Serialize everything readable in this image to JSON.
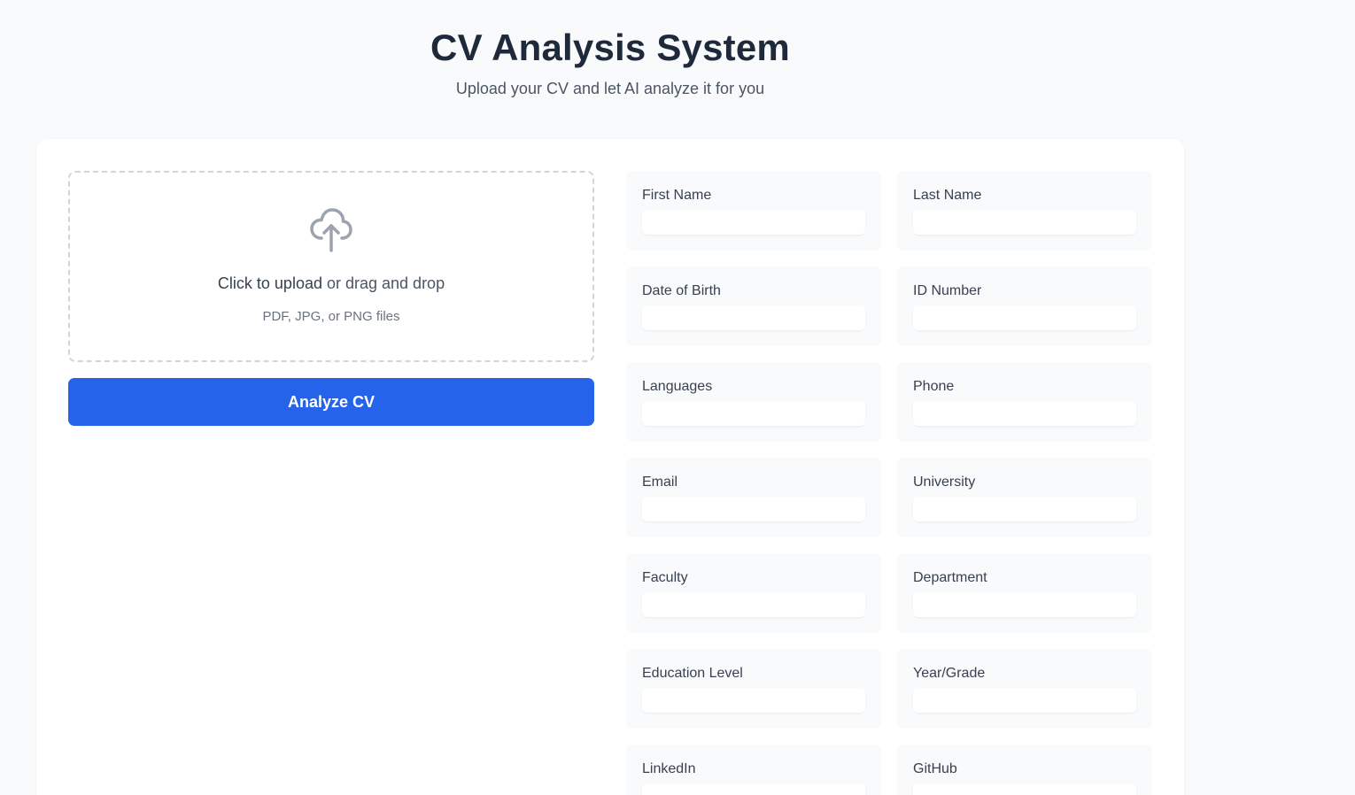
{
  "header": {
    "title": "CV Analysis System",
    "subtitle": "Upload your CV and let AI analyze it for you"
  },
  "upload": {
    "icon": "cloud-upload-icon",
    "link_text": "Click to upload",
    "rest_text": " or drag and drop",
    "hint": "PDF, JPG, or PNG files"
  },
  "analyze_button": {
    "label": "Analyze CV",
    "color": "#2563eb"
  },
  "fields": [
    {
      "label": "First Name",
      "value": ""
    },
    {
      "label": "Last Name",
      "value": ""
    },
    {
      "label": "Date of Birth",
      "value": ""
    },
    {
      "label": "ID Number",
      "value": ""
    },
    {
      "label": "Languages",
      "value": ""
    },
    {
      "label": "Phone",
      "value": ""
    },
    {
      "label": "Email",
      "value": ""
    },
    {
      "label": "University",
      "value": ""
    },
    {
      "label": "Faculty",
      "value": ""
    },
    {
      "label": "Department",
      "value": ""
    },
    {
      "label": "Education Level",
      "value": ""
    },
    {
      "label": "Year/Grade",
      "value": ""
    },
    {
      "label": "LinkedIn",
      "value": ""
    },
    {
      "label": "GitHub",
      "value": ""
    }
  ]
}
